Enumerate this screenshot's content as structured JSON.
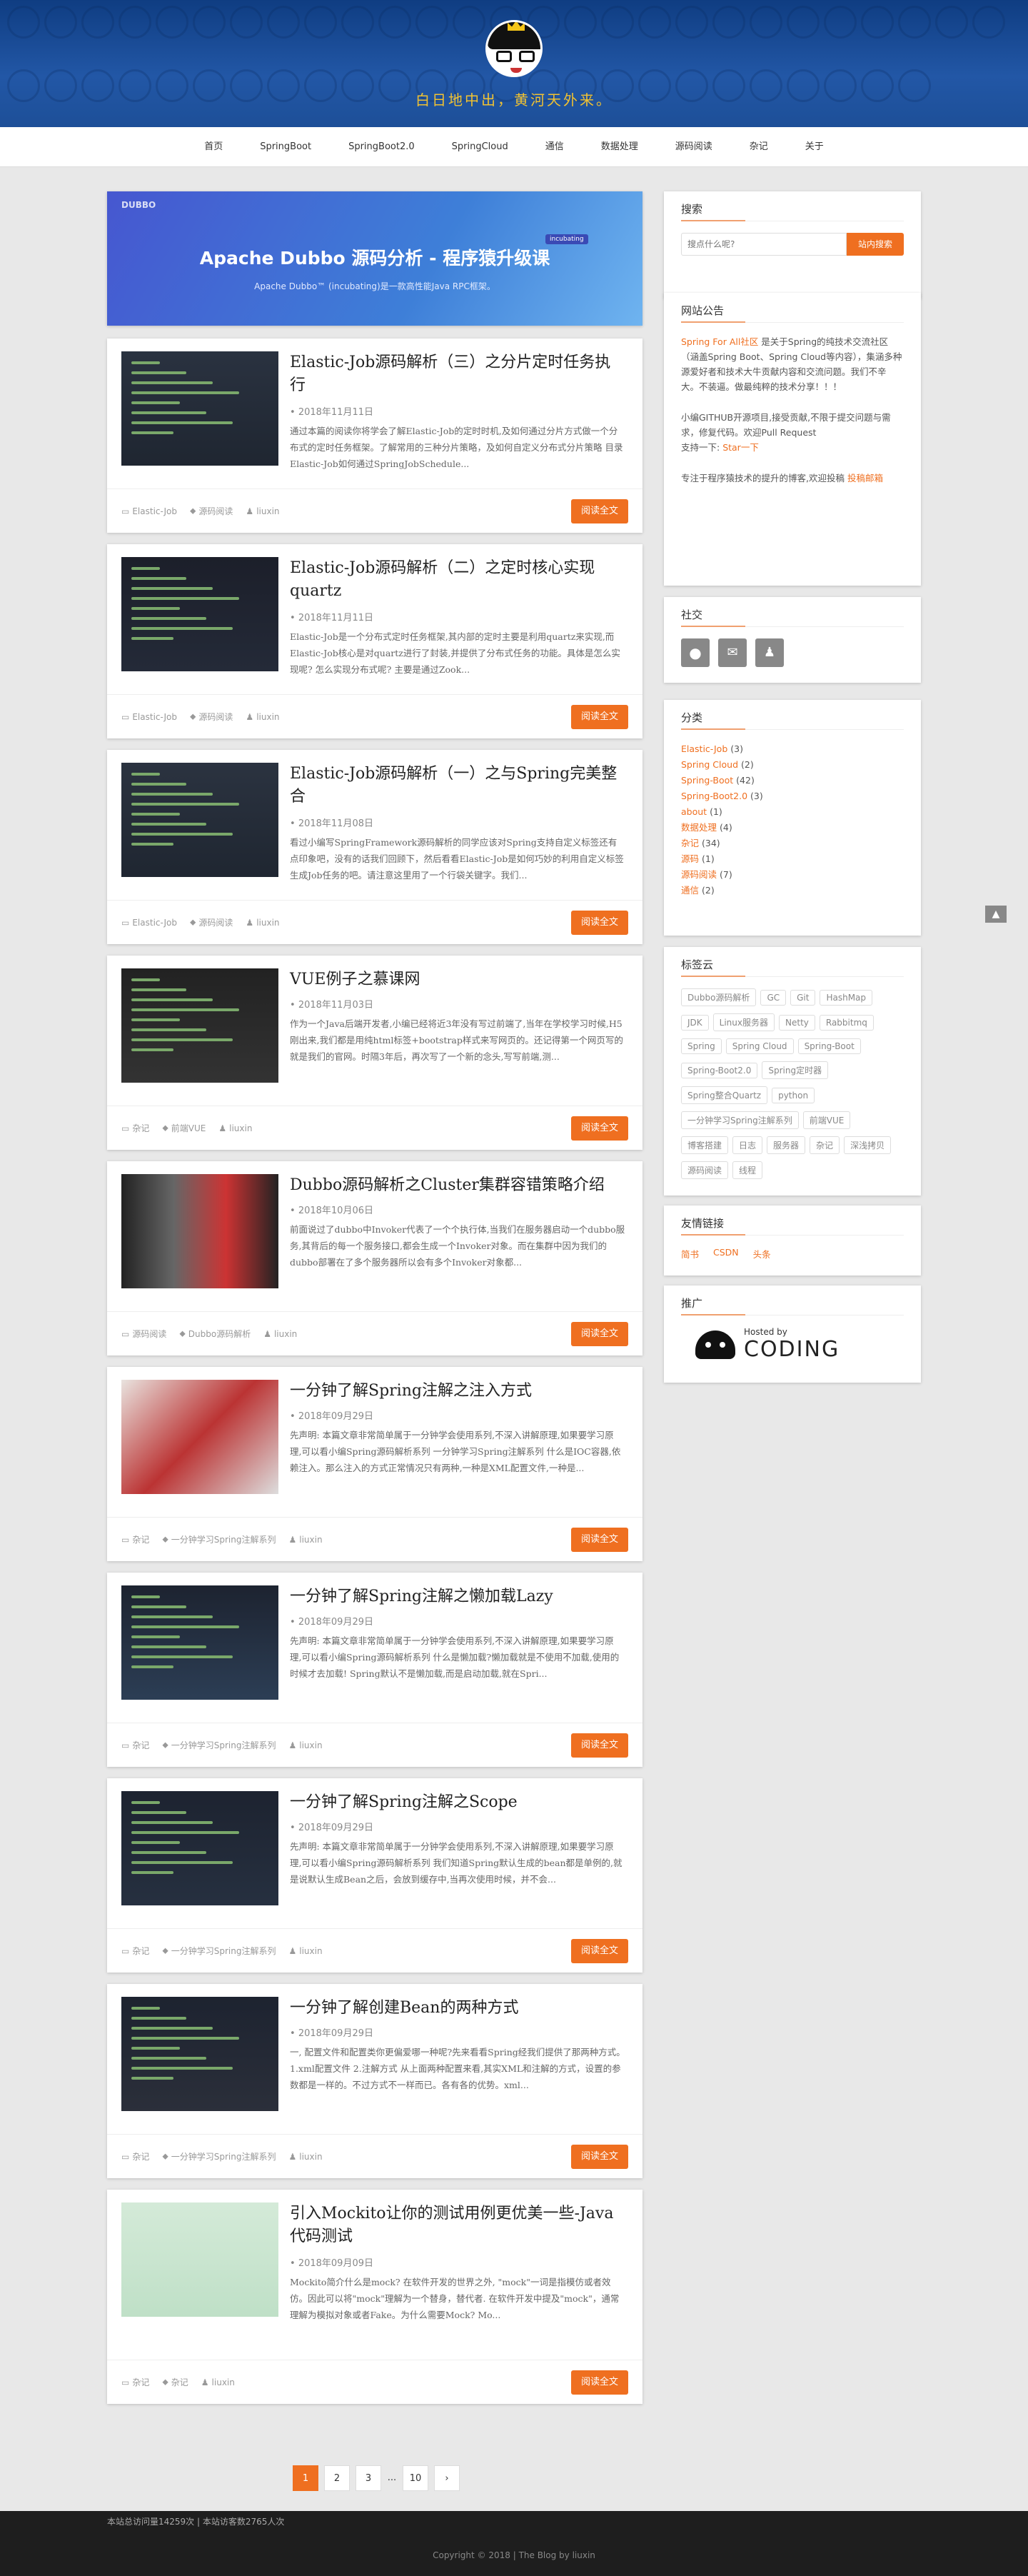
{
  "site": {
    "motto": "白日地中出，黄河天外来。"
  },
  "nav": [
    "首页",
    "SpringBoot",
    "SpringBoot2.0",
    "SpringCloud",
    "通信",
    "数据处理",
    "源码阅读",
    "杂记",
    "关于"
  ],
  "banner": {
    "logo": "DUBBO",
    "title": "Apache Dubbo 源码分析 - 程序猿升级课",
    "tag": "incubating",
    "subtitle": "Apache Dubbo™ (incubating)是一款高性能Java RPC框架。"
  },
  "posts": [
    {
      "title": "Elastic-Job源码解析（三）之分片定时任务执行",
      "date": "2018年11月11日",
      "excerpt": "通过本篇的阅读你将学会了解Elastic-Job的定时时机,及如何通过分片方式做一个分布式的定时任务框架。了解常用的三种分片策略，及如何自定义分布式分片策略 目录 Elastic-Job如何通过SpringJobSchedule...",
      "meta": [
        "Elastic-Job",
        "源码阅读",
        "liuxin"
      ]
    },
    {
      "title": "Elastic-Job源码解析（二）之定时核心实现quartz",
      "date": "2018年11月11日",
      "excerpt": "Elastic-Job是一个分布式定时任务框架,其内部的定时主要是利用quartz来实现,而Elastic-Job核心是对quartz进行了封装,并提供了分布式任务的功能。具体是怎么实现呢? 怎么实现分布式呢? 主要是通过Zook...",
      "meta": [
        "Elastic-Job",
        "源码阅读",
        "liuxin"
      ]
    },
    {
      "title": "Elastic-Job源码解析（一）之与Spring完美整合",
      "date": "2018年11月08日",
      "excerpt": "看过小编写SpringFramework源码解析的同学应该对Spring支持自定义标签还有点印象吧，没有的话我们回顾下，然后看看Elastic-Job是如何巧妙的利用自定义标签生成Job任务的吧。请注意这里用了一个行袋关键字。我们...",
      "meta": [
        "Elastic-Job",
        "源码阅读",
        "liuxin"
      ]
    },
    {
      "title": "VUE例子之慕课网",
      "date": "2018年11月03日",
      "excerpt": "作为一个Java后端开发者,小编已经将近3年没有写过前端了,当年在学校学习时候,H5刚出来,我们都是用纯html标签+bootstrap样式来写网页的。还记得第一个网页写的就是我们的官网。时隔3年后，再次写了一个新的念头,写写前端,测...",
      "meta": [
        "杂记",
        "前端VUE",
        "liuxin"
      ]
    },
    {
      "title": "Dubbo源码解析之Cluster集群容错策略介绍",
      "date": "2018年10月06日",
      "excerpt": "前面说过了dubbo中Invoker代表了一个个执行体,当我们在服务器启动一个dubbo服务,其背后的每一个服务接口,都会生成一个Invoker对象。而在集群中因为我们的dubbo部署在了多个服务器所以会有多个Invoker对象都...",
      "meta": [
        "源码阅读",
        "Dubbo源码解析",
        "liuxin"
      ]
    },
    {
      "title": "一分钟了解Spring注解之注入方式",
      "date": "2018年09月29日",
      "excerpt": "先声明: 本篇文章非常简单属于一分钟学会使用系列,不深入讲解原理,如果要学习原理,可以看小编Spring源码解析系列 一分钟学习Spring注解系列 什么是IOC容器,依赖注入。那么注入的方式正常情况只有两种,一种是XML配置文件,一种是...",
      "meta": [
        "杂记",
        "一分钟学习Spring注解系列",
        "liuxin"
      ]
    },
    {
      "title": "一分钟了解Spring注解之懒加载Lazy",
      "date": "2018年09月29日",
      "excerpt": "先声明: 本篇文章非常简单属于一分钟学会使用系列,不深入讲解原理,如果要学习原理,可以看小编Spring源码解析系列 什么是懒加载?懒加载就是不使用不加载,使用的时候才去加载! Spring默认不是懒加载,而是启动加载,就在Spri...",
      "meta": [
        "杂记",
        "一分钟学习Spring注解系列",
        "liuxin"
      ]
    },
    {
      "title": "一分钟了解Spring注解之Scope",
      "date": "2018年09月29日",
      "excerpt": "先声明: 本篇文章非常简单属于一分钟学会使用系列,不深入讲解原理,如果要学习原理,可以看小编Spring源码解析系列 我们知道Spring默认生成的bean都是单例的,就是说默认生成Bean之后，会放到缓存中,当再次使用时候，并不会...",
      "meta": [
        "杂记",
        "一分钟学习Spring注解系列",
        "liuxin"
      ]
    },
    {
      "title": "一分钟了解创建Bean的两种方式",
      "date": "2018年09月29日",
      "excerpt": "一, 配置文件和配置类你更偏爱哪一种呢?先来看看Spring经我们提供了那两种方式。1.xml配置文件 2.注解方式 从上面两种配置来看,其实XML和注解的方式，设置的参数都是一样的。不过方式不一样而已。各有各的优势。xml...",
      "meta": [
        "杂记",
        "一分钟学习Spring注解系列",
        "liuxin"
      ]
    },
    {
      "title": "引入Mockito让你的测试用例更优美一些-Java代码测试",
      "date": "2018年09月09日",
      "excerpt": "Mockito简介什么是mock? 在软件开发的世界之外, \"mock\"一词是指模仿或者效仿。因此可以将\"mock\"理解为一个替身，替代者. 在软件开发中提及\"mock\"，通常理解为模拟对象或者Fake。为什么需要Mock? Mo...",
      "meta": [
        "杂记",
        "杂记",
        "liuxin"
      ]
    }
  ],
  "read_more": "阅读全文",
  "pager": [
    "1",
    "2",
    "3",
    "...",
    "10",
    "›"
  ],
  "sidebar": {
    "search": {
      "title": "搜索",
      "placeholder": "搜点什么呢?",
      "button": "站内搜索"
    },
    "notice": {
      "title": "网站公告",
      "p1_link": "Spring For All社区",
      "p1": " 是关于Spring的纯技术交流社区（涵盖Spring Boot、Spring Cloud等内容），集涵多种源爱好者和技术大牛贡献内容和交流问题。我们不辛大。不装逼。做最纯粹的技术分享！！！",
      "p2": "小编GITHUB开源项目,接受贡献,不限于提交问题与需求，修复代码。欢迎Pull Request",
      "p2b": "支持一下: ",
      "p2_link": "Star一下",
      "p3": "专注于程序猿技术的提升的博客,欢迎投稿 ",
      "p3_link": "投稿邮箱"
    },
    "social": {
      "title": "社交"
    },
    "categories": {
      "title": "分类",
      "items": [
        [
          "Elastic-Job",
          "(3)"
        ],
        [
          "Spring Cloud",
          "(2)"
        ],
        [
          "Spring-Boot",
          "(42)"
        ],
        [
          "Spring-Boot2.0",
          "(3)"
        ],
        [
          "about",
          "(1)"
        ],
        [
          "数据处理",
          "(4)"
        ],
        [
          "杂记",
          "(34)"
        ],
        [
          "源码",
          "(1)"
        ],
        [
          "源码阅读",
          "(7)"
        ],
        [
          "通信",
          "(2)"
        ]
      ]
    },
    "tags": {
      "title": "标签云",
      "items": [
        "Dubbo源码解析",
        "GC",
        "Git",
        "HashMap",
        "JDK",
        "Linux服务器",
        "Netty",
        "Rabbitmq",
        "Spring",
        "Spring Cloud",
        "Spring-Boot",
        "Spring-Boot2.0",
        "Spring定时器",
        "Spring整合Quartz",
        "python",
        "一分钟学习Spring注解系列",
        "前端VUE",
        "博客搭建",
        "日志",
        "服务器",
        "杂记",
        "深浅拷贝",
        "源码阅读",
        "线程"
      ]
    },
    "links": {
      "title": "友情链接",
      "items": [
        "简书",
        "CSDN",
        "头条"
      ]
    },
    "promo": {
      "title": "推广",
      "hosted": "Hosted by",
      "brand": "CODING"
    }
  },
  "footer": {
    "visits": "本站总访问量14259次 | 本站访客数2765人次",
    "copy": "Copyright © 2018   |   The Blog by liuxin"
  },
  "colors": {
    "accent": "#ef6f20",
    "header": "#1d4f98",
    "motto": "#f1c232"
  }
}
